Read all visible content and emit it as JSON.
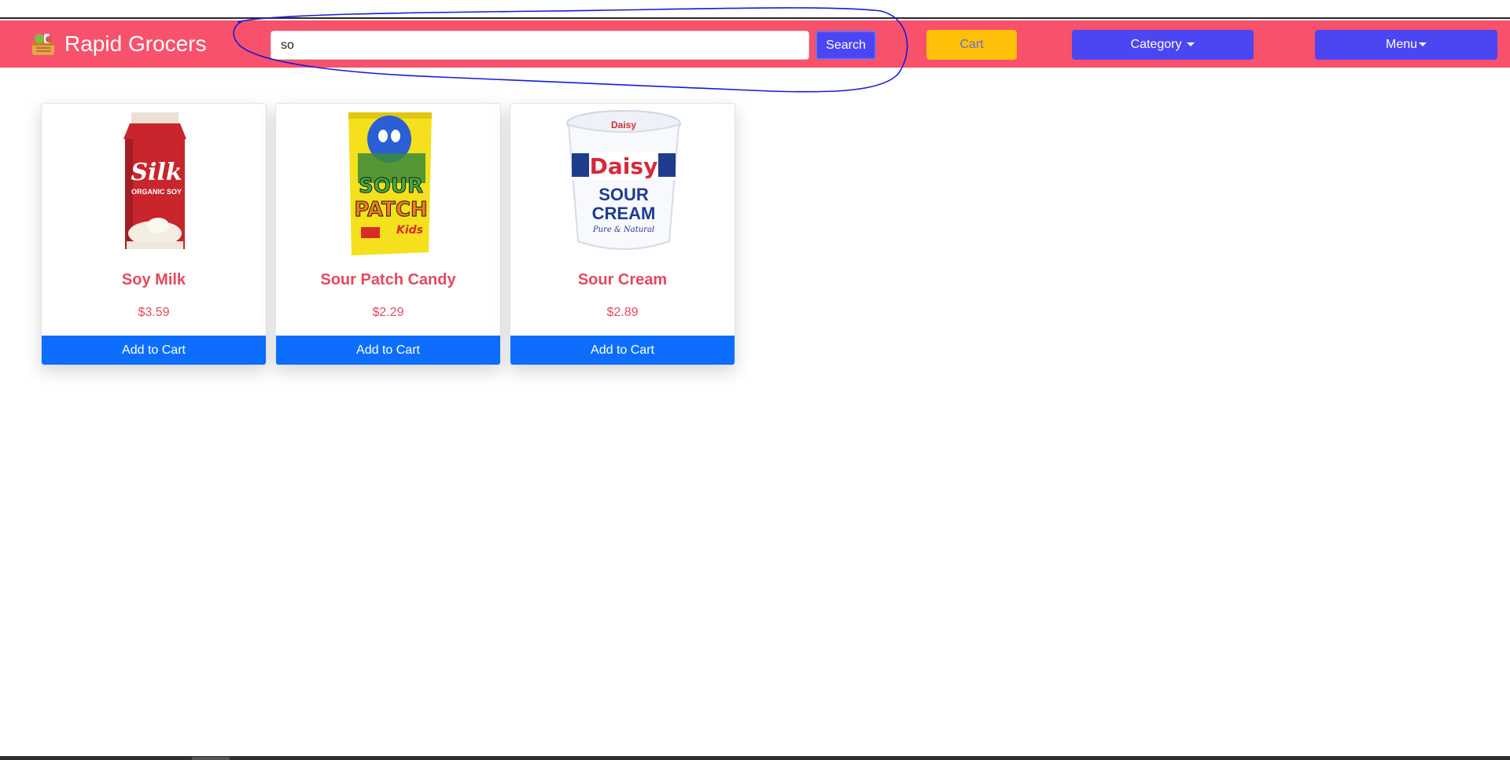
{
  "navbar": {
    "brand": "Rapid Grocers",
    "brand_icon": "grocery-basket-icon",
    "background": "#f7516b"
  },
  "search": {
    "value": "so",
    "button_label": "Search"
  },
  "nav_buttons": {
    "cart": "Cart",
    "category": "Category",
    "menu": "Menu"
  },
  "products": [
    {
      "name": "Soy Milk",
      "price": "$3.59",
      "button": "Add to Cart",
      "image": "silk-organic-soy-carton"
    },
    {
      "name": "Sour Patch Candy",
      "price": "$2.29",
      "button": "Add to Cart",
      "image": "sour-patch-kids-bag"
    },
    {
      "name": "Sour Cream",
      "price": "$2.89",
      "button": "Add to Cart",
      "image": "daisy-sour-cream-tub"
    }
  ],
  "image_text": {
    "silk_brand": "Silk",
    "silk_sub": "ORGANIC SOY",
    "candy_line1": "SOUR",
    "candy_line2": "PATCH",
    "candy_line3": "Kids",
    "daisy_brand": "Daisy",
    "daisy_line1": "SOUR",
    "daisy_line2": "CREAM",
    "daisy_tag": "Pure & Natural"
  },
  "colors": {
    "accent_red": "#e5495f",
    "primary_blue": "#0d6efd",
    "indigo": "#4b46f2",
    "cart_yellow": "#ffc107",
    "annotation": "#1a1ad8"
  }
}
